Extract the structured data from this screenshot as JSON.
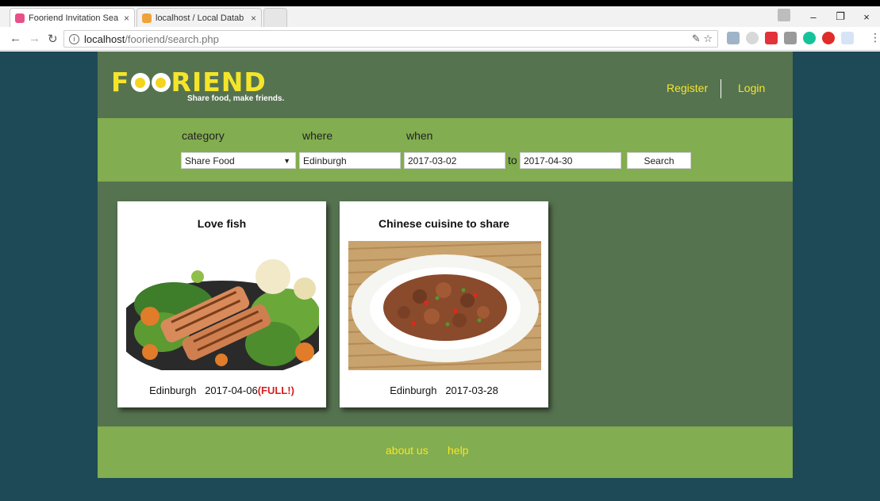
{
  "browser": {
    "tabs": [
      {
        "title": "Fooriend Invitation Sea",
        "close": "×"
      },
      {
        "title": "localhost / Local Datab",
        "close": "×"
      }
    ],
    "url_host": "localhost",
    "url_path": "/fooriend/search.php",
    "window_controls": {
      "minimize": "–",
      "restore": "❐",
      "close": "×"
    },
    "omnibox_icons": "✎ ☆",
    "menu": "⋮"
  },
  "site": {
    "logo_letters": [
      "F",
      "RIEND"
    ],
    "tagline": "Share food, make friends.",
    "nav": {
      "register": "Register",
      "login": "Login"
    },
    "search": {
      "category_label": "category",
      "where_label": "where",
      "when_label": "when",
      "category_value": "Share Food",
      "category_caret": "▼",
      "where_value": "Edinburgh",
      "from_date": "2017-03-02",
      "to_label": "to",
      "to_date": "2017-04-30",
      "button": "Search"
    },
    "cards": [
      {
        "title": "Love fish",
        "location": "Edinburgh",
        "date": "2017-04-06",
        "status": "(FULL!)"
      },
      {
        "title": "Chinese cuisine to share",
        "location": "Edinburgh",
        "date": "2017-03-28"
      }
    ],
    "footer": {
      "about": "about us",
      "help": "help"
    }
  },
  "colors": {
    "page_bg": "#1d4a56",
    "header_bg": "#567350",
    "band_bg": "#82ad50",
    "accent_yellow": "#f5e52a",
    "full_red": "#d91e1e"
  }
}
